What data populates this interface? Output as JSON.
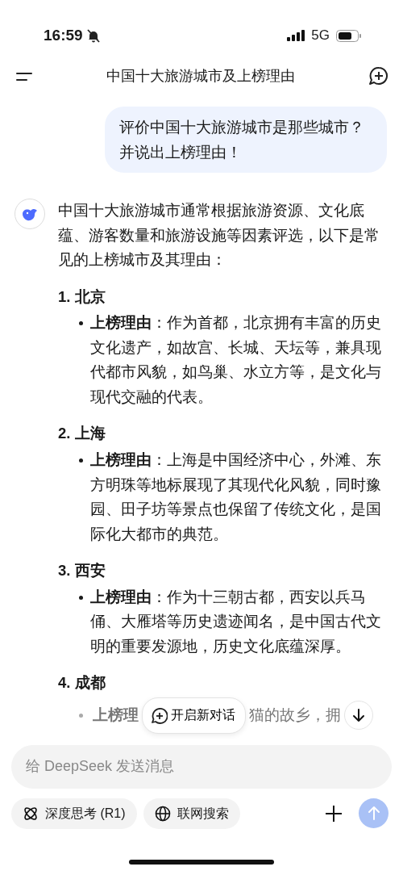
{
  "status_bar": {
    "time": "16:59",
    "network": "5G"
  },
  "header": {
    "title": "中国十大旅游城市及上榜理由"
  },
  "user_message": {
    "text": "评价中国十大旅游城市是那些城市？并说出上榜理由！"
  },
  "assistant_message": {
    "intro": "中国十大旅游城市通常根据旅游资源、文化底蕴、游客数量和旅游设施等因素评选，以下是常见的上榜城市及其理由：",
    "items": [
      {
        "number": "1.",
        "city": "北京",
        "reason": "**上榜理由**：作为首都，北京拥有丰富的历史文化遗产，如故宫、长城、天坛等，兼具现代都市风貌，如鸟巢、水立方等，是文化与现代交融的代表。"
      },
      {
        "number": "2.",
        "city": "上海",
        "reason": "**上榜理由**：上海是中国经济中心，外滩、东方明珠等地标展现了其现代化风貌，同时豫园、田子坊等景点也保留了传统文化，是国际化大都市的典范。"
      },
      {
        "number": "3.",
        "city": "西安",
        "reason": "**上榜理由**：作为十三朝古都，西安以兵马俑、大雁塔等历史遗迹闻名，是中国古代文明的重要发源地，历史文化底蕴深厚。"
      },
      {
        "number": "4.",
        "city": "成都",
        "reason_fragments": [
          "上榜理",
          "猫的故乡，拥"
        ]
      }
    ]
  },
  "new_chat_button": {
    "label": "开启新对话"
  },
  "composer": {
    "placeholder": "给 DeepSeek 发送消息"
  },
  "toolbar": [
    {
      "kind": "think",
      "label": "深度思考 (R1)",
      "selected": false
    },
    {
      "kind": "web",
      "label": "联网搜索",
      "selected": false
    }
  ],
  "send_button": {
    "disabled": true
  }
}
